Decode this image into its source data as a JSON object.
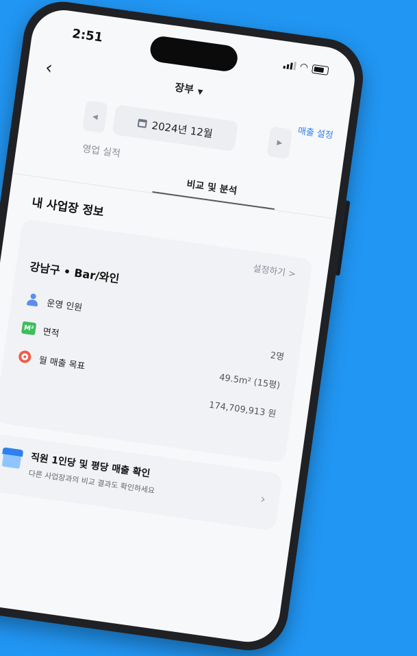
{
  "status_bar": {
    "time": "2:51"
  },
  "header": {
    "back_glyph": "‹",
    "title": "장부",
    "caret_glyph": "▼",
    "sales_setting": "매출 설정"
  },
  "month_nav": {
    "prev_glyph": "◀",
    "label": "2024년 12월",
    "next_glyph": "▶"
  },
  "tabs": [
    {
      "label": "영업 실적"
    },
    {
      "label": "비교 및 분석"
    }
  ],
  "section": {
    "title": "내 사업장 정보"
  },
  "card": {
    "setting_link": "설정하기 >",
    "business_name": "강남구 • Bar/와인",
    "rows": [
      {
        "icon": "people-icon",
        "label": "운영 인원",
        "value": "2명"
      },
      {
        "icon": "m2-area-icon",
        "icon_text": "M²",
        "label": "면적",
        "value": "49.5m² (15평)"
      },
      {
        "icon": "target-icon",
        "label": "월 매출 목표",
        "value": "174,709,913 원"
      }
    ]
  },
  "banner": {
    "icon": "store-icon",
    "title": "직원 1인당 및 평당 매출 확인",
    "subtitle": "다른 사업장과의 비교 결과도 확인하세요",
    "arrow_glyph": "›"
  },
  "colors": {
    "background": "#2196f3",
    "accent": "#2f80ed",
    "card": "#f1f2f5"
  }
}
